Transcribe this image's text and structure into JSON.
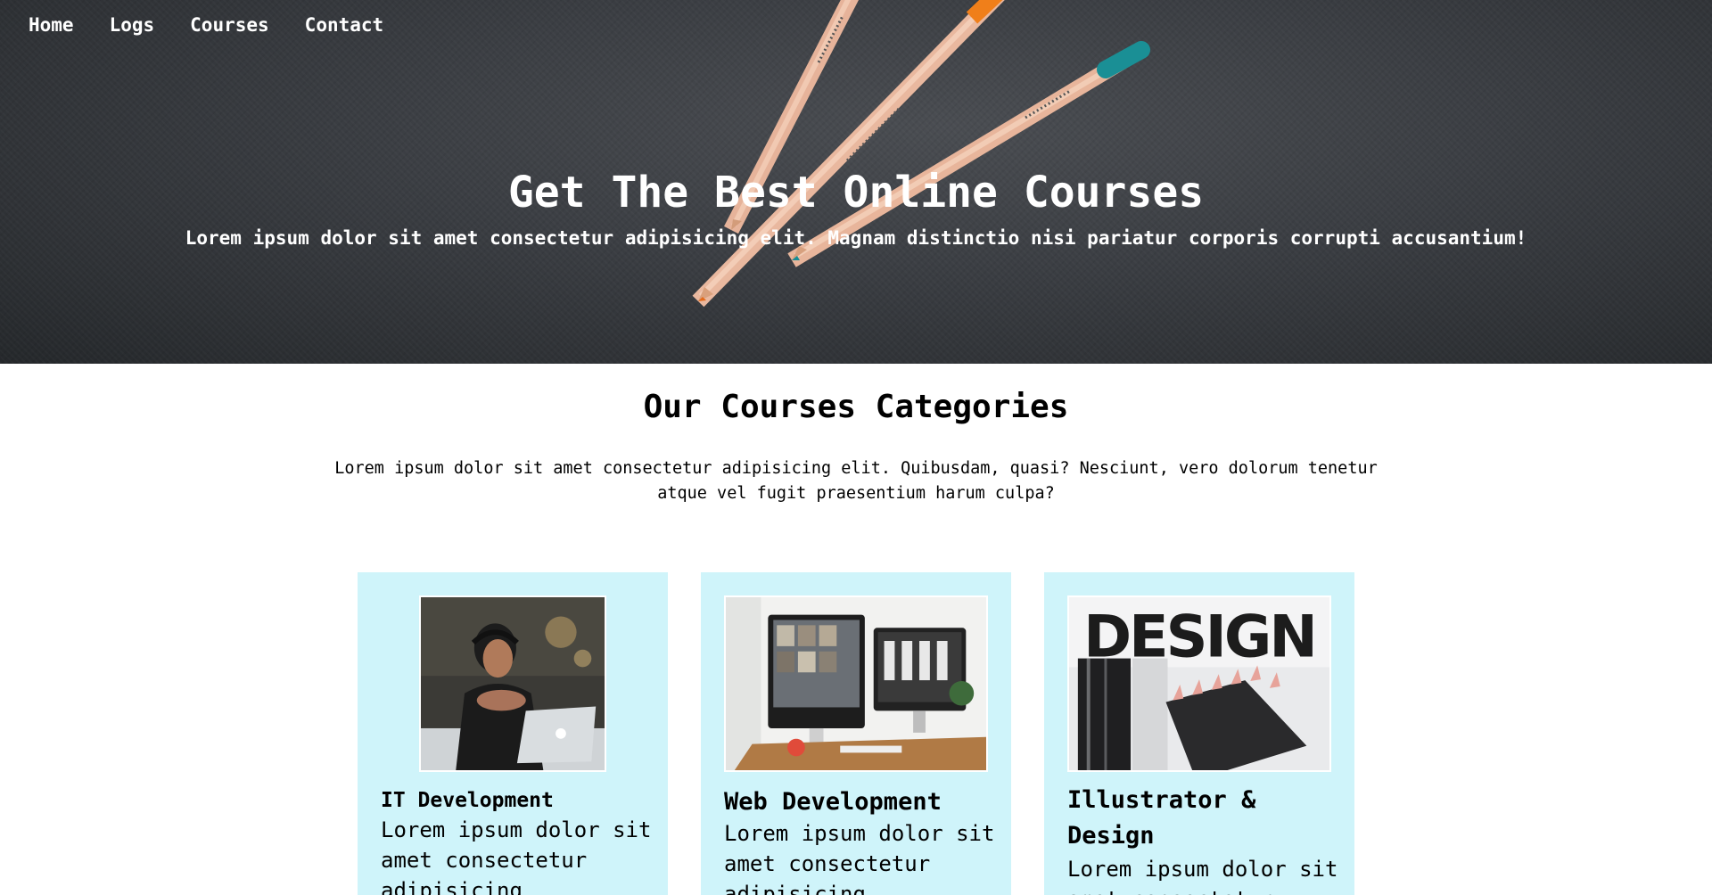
{
  "nav": {
    "items": [
      {
        "label": "Home"
      },
      {
        "label": "Logs"
      },
      {
        "label": "Courses"
      },
      {
        "label": "Contact"
      }
    ]
  },
  "hero": {
    "title": "Get The Best Online Courses",
    "subtitle": "Lorem ipsum dolor sit amet consectetur adipisicing elit. Magnam distinctio nisi pariatur corporis corrupti accusantium!",
    "image": "pencils-on-dark-background"
  },
  "categories": {
    "title": "Our Courses Categories",
    "description": "Lorem ipsum dolor sit amet consectetur adipisicing elit. Quibusdam, quasi? Nesciunt, vero dolorum tenetur atque vel fugit praesentium harum culpa?",
    "cards": [
      {
        "title": "IT Development",
        "text": "Lorem ipsum dolor sit amet consectetur adipisicing",
        "image": "person-at-laptop-photo"
      },
      {
        "title": "Web Development",
        "text": "Lorem ipsum dolor sit amet consectetur adipisicing",
        "image": "desk-monitors-photo"
      },
      {
        "title": "Illustrator & Design",
        "text": "Lorem ipsum dolor sit amet consectetur",
        "image": "design-pencils-photo",
        "image_text": "DESIGN"
      }
    ]
  },
  "colors": {
    "card_background": "#cff4fa",
    "hero_background": "#3a3d42",
    "text": "#000000"
  }
}
